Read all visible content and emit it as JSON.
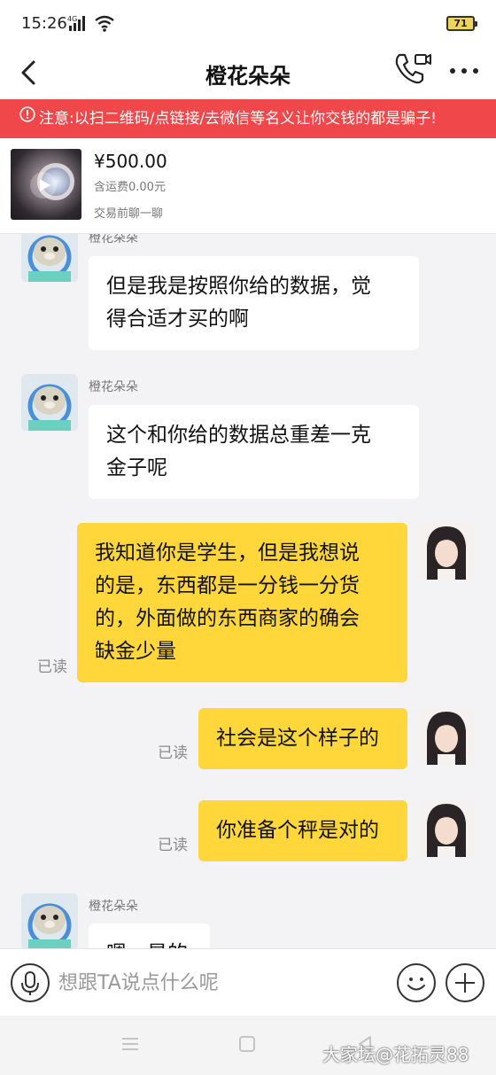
{
  "status_bar": {
    "time": "15:26",
    "network": "4G",
    "battery": "71"
  },
  "header": {
    "title": "橙花朵朵"
  },
  "warning": {
    "text": "注意:以扫二维码/点链接/去微信等名义让你交钱的都是骗子!"
  },
  "product": {
    "price": "¥500.00",
    "shipping": "含运费0.00元",
    "chat_hint": "交易前聊一聊"
  },
  "messages": [
    {
      "side": "in",
      "sender": "橙花朵朵",
      "lines": [
        "但是我是按照你给的数据，觉",
        "得合适才买的啊"
      ]
    },
    {
      "side": "in",
      "sender": "橙花朵朵",
      "lines": [
        "这个和你给的数据总重差一克",
        "金子呢"
      ]
    },
    {
      "side": "out",
      "status": "已读",
      "lines": [
        "我知道你是学生，但是我想说",
        "的是，东西都是一分钱一分货",
        "的，外面做的东西商家的确会",
        "缺金少量"
      ]
    },
    {
      "side": "out",
      "status": "已读",
      "lines": [
        "社会是这个样子的"
      ]
    },
    {
      "side": "out",
      "status": "已读",
      "lines": [
        "你准备个秤是对的"
      ]
    },
    {
      "side": "in",
      "sender": "橙花朵朵",
      "lines": [
        "嗯，是的"
      ]
    }
  ],
  "input": {
    "placeholder": "想跟TA说点什么呢"
  },
  "watermark": "大家坛@花拓灵88",
  "colors": {
    "warning_bg": "#f0474b",
    "outgoing_bubble": "#ffd73a",
    "incoming_bubble": "#ffffff",
    "chat_bg": "#f3f3f6"
  }
}
